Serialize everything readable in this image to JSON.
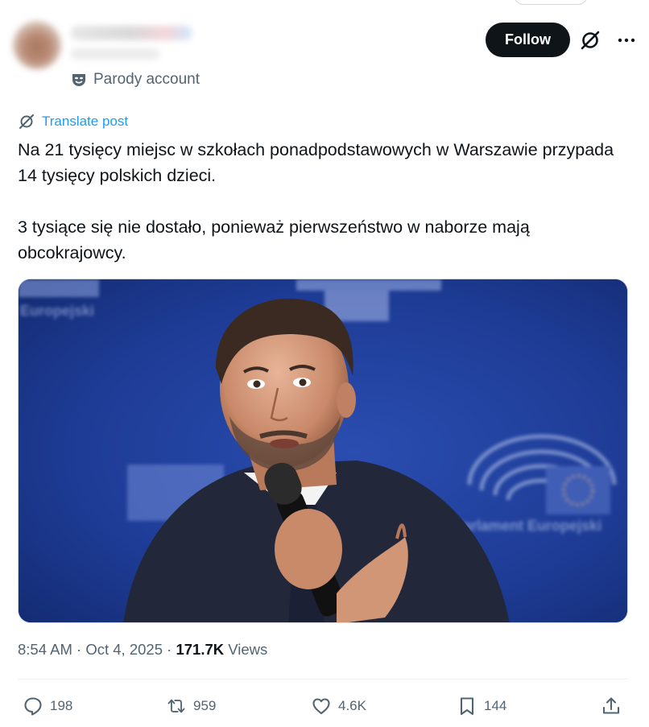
{
  "header": {
    "follow_label": "Follow",
    "parody_label": "Parody account"
  },
  "post": {
    "translate_label": "Translate post",
    "paragraph1": "Na 21 tysięcy miejsc w szkołach ponadpodstawowych w Warszawie przypada 14 tysięcy polskich dzieci.",
    "paragraph2": "3 tysiące się nie dostało, ponieważ pierwszeństwo w naborze mają obcokrajowcy.",
    "time": "8:54 AM",
    "date": "Oct 4, 2025",
    "views_count": "171.7K",
    "views_label": "Views"
  },
  "media": {
    "backdrop_text_left": "Europejski",
    "backdrop_text_right": "Parlament Europejski"
  },
  "actions": {
    "replies": "198",
    "reposts": "959",
    "likes": "4.6K",
    "bookmarks": "144"
  },
  "colors": {
    "accent": "#1d9bf0",
    "text_primary": "#0f1419",
    "text_secondary": "#536471",
    "follow_bg": "#0f1419",
    "media_backdrop": "#1d3a8f"
  }
}
